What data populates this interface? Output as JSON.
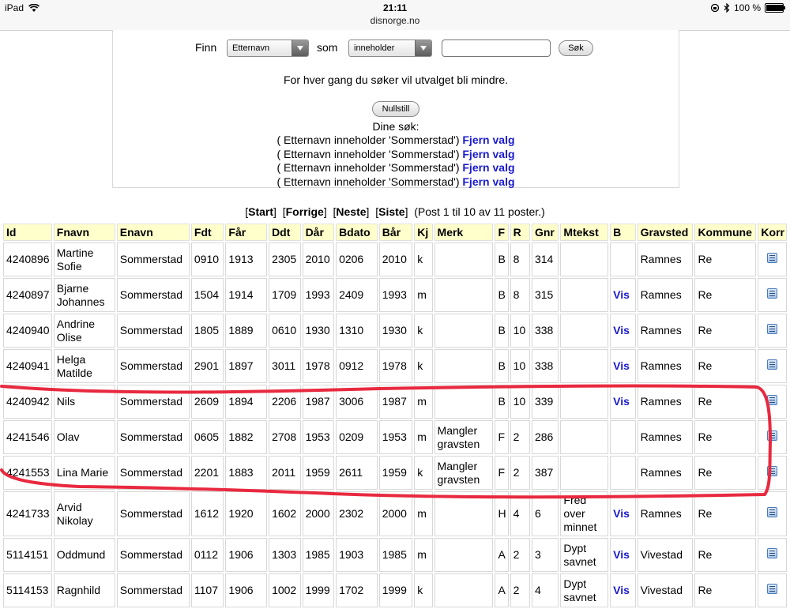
{
  "status_bar": {
    "device": "iPad",
    "time": "21:11",
    "url": "disnorge.no",
    "battery": "100 %",
    "battery_level": 1.0
  },
  "search": {
    "finn_label": "Finn",
    "field_select": "Etternavn",
    "som_label": "som",
    "operator_select": "inneholder",
    "query_value": "",
    "search_button": "Søk",
    "info": "For hver gang du søker vil utvalget bli mindre.",
    "reset_button": "Nullstill",
    "dine_sok_label": "Dine søk:",
    "queries": [
      {
        "text": "( Etternavn inneholder 'Sommerstad')",
        "remove": "Fjern valg"
      },
      {
        "text": "( Etternavn inneholder 'Sommerstad')",
        "remove": "Fjern valg"
      },
      {
        "text": "( Etternavn inneholder 'Sommerstad')",
        "remove": "Fjern valg"
      },
      {
        "text": "( Etternavn inneholder 'Sommerstad')",
        "remove": "Fjern valg"
      }
    ]
  },
  "pagination": {
    "start": "Start",
    "prev": "Forrige",
    "next": "Neste",
    "last": "Siste",
    "summary": "(Post 1 til 10 av 11 poster.)"
  },
  "table": {
    "columns": [
      "Id",
      "Fnavn",
      "Enavn",
      "Fdt",
      "Får",
      "Ddt",
      "Dår",
      "Bdato",
      "Bår",
      "Kj",
      "Merk",
      "F",
      "R",
      "Gnr",
      "Mtekst",
      "B",
      "Gravsted",
      "Kommune",
      "Korr"
    ],
    "rows": [
      {
        "id": "4240896",
        "fnavn": "Martine Sofie",
        "enavn": "Sommerstad",
        "fdt": "0910",
        "far": "1913",
        "ddt": "2305",
        "dar": "2010",
        "bdato": "0206",
        "bar": "2010",
        "kj": "k",
        "merk": "",
        "f": "B",
        "r": "8",
        "gnr": "314",
        "mtekst": "",
        "b": "",
        "gravsted": "Ramnes",
        "kommune": "Re"
      },
      {
        "id": "4240897",
        "fnavn": "Bjarne Johannes",
        "enavn": "Sommerstad",
        "fdt": "1504",
        "far": "1914",
        "ddt": "1709",
        "dar": "1993",
        "bdato": "2409",
        "bar": "1993",
        "kj": "m",
        "merk": "",
        "f": "B",
        "r": "8",
        "gnr": "315",
        "mtekst": "",
        "b": "Vis",
        "gravsted": "Ramnes",
        "kommune": "Re"
      },
      {
        "id": "4240940",
        "fnavn": "Andrine Olise",
        "enavn": "Sommerstad",
        "fdt": "1805",
        "far": "1889",
        "ddt": "0610",
        "dar": "1930",
        "bdato": "1310",
        "bar": "1930",
        "kj": "k",
        "merk": "",
        "f": "B",
        "r": "10",
        "gnr": "338",
        "mtekst": "",
        "b": "Vis",
        "gravsted": "Ramnes",
        "kommune": "Re"
      },
      {
        "id": "4240941",
        "fnavn": "Helga Matilde",
        "enavn": "Sommerstad",
        "fdt": "2901",
        "far": "1897",
        "ddt": "3011",
        "dar": "1978",
        "bdato": "0912",
        "bar": "1978",
        "kj": "k",
        "merk": "",
        "f": "B",
        "r": "10",
        "gnr": "338",
        "mtekst": "",
        "b": "Vis",
        "gravsted": "Ramnes",
        "kommune": "Re"
      },
      {
        "id": "4240942",
        "fnavn": "Nils",
        "enavn": "Sommerstad",
        "fdt": "2609",
        "far": "1894",
        "ddt": "2206",
        "dar": "1987",
        "bdato": "3006",
        "bar": "1987",
        "kj": "m",
        "merk": "",
        "f": "B",
        "r": "10",
        "gnr": "339",
        "mtekst": "",
        "b": "Vis",
        "gravsted": "Ramnes",
        "kommune": "Re"
      },
      {
        "id": "4241546",
        "fnavn": "Olav",
        "enavn": "Sommerstad",
        "fdt": "0605",
        "far": "1882",
        "ddt": "2708",
        "dar": "1953",
        "bdato": "0209",
        "bar": "1953",
        "kj": "m",
        "merk": "Mangler gravsten",
        "f": "F",
        "r": "2",
        "gnr": "286",
        "mtekst": "",
        "b": "",
        "gravsted": "Ramnes",
        "kommune": "Re"
      },
      {
        "id": "4241553",
        "fnavn": "Lina Marie",
        "enavn": "Sommerstad",
        "fdt": "2201",
        "far": "1883",
        "ddt": "2011",
        "dar": "1959",
        "bdato": "2611",
        "bar": "1959",
        "kj": "k",
        "merk": "Mangler gravsten",
        "f": "F",
        "r": "2",
        "gnr": "387",
        "mtekst": "",
        "b": "",
        "gravsted": "Ramnes",
        "kommune": "Re"
      },
      {
        "id": "4241733",
        "fnavn": "Arvid Nikolay",
        "enavn": "Sommerstad",
        "fdt": "1612",
        "far": "1920",
        "ddt": "1602",
        "dar": "2000",
        "bdato": "2302",
        "bar": "2000",
        "kj": "m",
        "merk": "",
        "f": "H",
        "r": "4",
        "gnr": "6",
        "mtekst": "Fred over minnet",
        "b": "Vis",
        "gravsted": "Ramnes",
        "kommune": "Re"
      },
      {
        "id": "5114151",
        "fnavn": "Oddmund",
        "enavn": "Sommerstad",
        "fdt": "0112",
        "far": "1906",
        "ddt": "1303",
        "dar": "1985",
        "bdato": "1903",
        "bar": "1985",
        "kj": "m",
        "merk": "",
        "f": "A",
        "r": "2",
        "gnr": "3",
        "mtekst": "Dypt savnet",
        "b": "Vis",
        "gravsted": "Vivestad",
        "kommune": "Re"
      },
      {
        "id": "5114153",
        "fnavn": "Ragnhild",
        "enavn": "Sommerstad",
        "fdt": "1107",
        "far": "1906",
        "ddt": "1002",
        "dar": "1999",
        "bdato": "1702",
        "bar": "1999",
        "kj": "k",
        "merk": "",
        "f": "A",
        "r": "2",
        "gnr": "4",
        "mtekst": "Dypt savnet",
        "b": "Vis",
        "gravsted": "Vivestad",
        "kommune": "Re"
      }
    ]
  },
  "colors": {
    "header_bg": "#ffffcc",
    "link": "#1a1ad0",
    "annotation": "#e8293f"
  }
}
